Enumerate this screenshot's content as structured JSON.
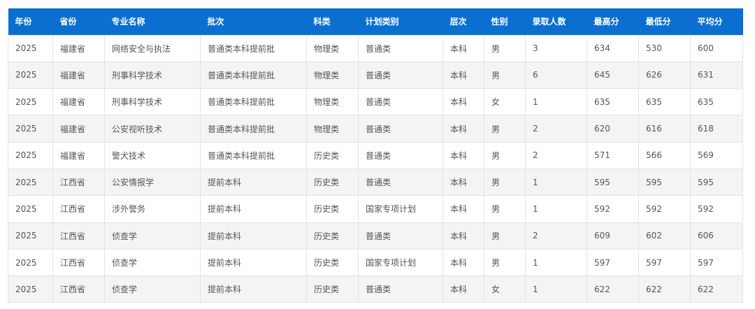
{
  "table": {
    "headers": [
      "年份",
      "省份",
      "专业名称",
      "批次",
      "科类",
      "计划类别",
      "层次",
      "性别",
      "录取人数",
      "最高分",
      "最低分",
      "平均分"
    ],
    "rows": [
      [
        "2025",
        "福建省",
        "网络安全与执法",
        "普通类本科提前批",
        "物理类",
        "普通类",
        "本科",
        "男",
        "3",
        "634",
        "530",
        "600"
      ],
      [
        "2025",
        "福建省",
        "刑事科学技术",
        "普通类本科提前批",
        "物理类",
        "普通类",
        "本科",
        "男",
        "6",
        "645",
        "626",
        "631"
      ],
      [
        "2025",
        "福建省",
        "刑事科学技术",
        "普通类本科提前批",
        "物理类",
        "普通类",
        "本科",
        "女",
        "1",
        "635",
        "635",
        "635"
      ],
      [
        "2025",
        "福建省",
        "公安视听技术",
        "普通类本科提前批",
        "物理类",
        "普通类",
        "本科",
        "男",
        "2",
        "620",
        "616",
        "618"
      ],
      [
        "2025",
        "福建省",
        "警犬技术",
        "普通类本科提前批",
        "历史类",
        "普通类",
        "本科",
        "男",
        "2",
        "571",
        "566",
        "569"
      ],
      [
        "2025",
        "江西省",
        "公安情报学",
        "提前本科",
        "历史类",
        "普通类",
        "本科",
        "男",
        "1",
        "595",
        "595",
        "595"
      ],
      [
        "2025",
        "江西省",
        "涉外警务",
        "提前本科",
        "历史类",
        "国家专项计划",
        "本科",
        "男",
        "1",
        "592",
        "592",
        "592"
      ],
      [
        "2025",
        "江西省",
        "侦查学",
        "提前本科",
        "历史类",
        "普通类",
        "本科",
        "男",
        "2",
        "609",
        "602",
        "606"
      ],
      [
        "2025",
        "江西省",
        "侦查学",
        "提前本科",
        "历史类",
        "国家专项计划",
        "本科",
        "男",
        "1",
        "597",
        "597",
        "597"
      ],
      [
        "2025",
        "江西省",
        "侦查学",
        "提前本科",
        "历史类",
        "普通类",
        "本科",
        "女",
        "1",
        "622",
        "622",
        "622"
      ]
    ]
  },
  "colors": {
    "header_bg": "#0a6fd0",
    "header_text": "#ffffff",
    "cell_text": "#555555",
    "row_alt_bg": "#f4f4f4",
    "border": "#e3e3e3"
  }
}
